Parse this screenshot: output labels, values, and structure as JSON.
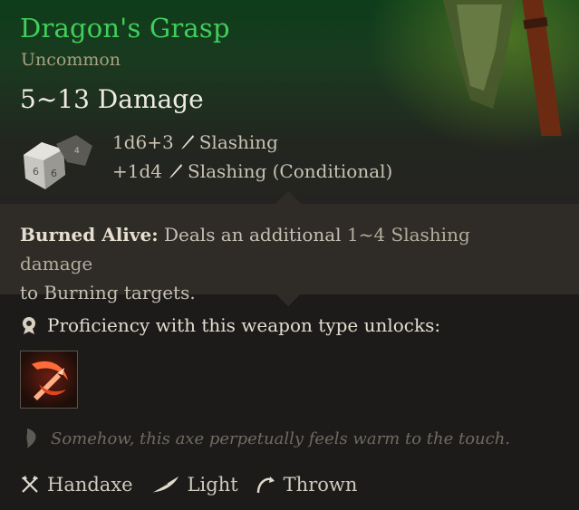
{
  "item": {
    "name": "Dragon's Grasp",
    "rarity": "Uncommon",
    "damage_range": "5~13 Damage",
    "damage_lines": [
      {
        "dice": "1d6+3",
        "type": "Slashing"
      },
      {
        "dice": "+1d4",
        "type": "Slashing (Conditional)"
      }
    ]
  },
  "passive": {
    "name": "Burned Alive:",
    "text_a": " Deals an additional ",
    "amount": "1~4 Slashing damage",
    "text_b": "to Burning targets."
  },
  "proficiency": {
    "label": "Proficiency with this weapon type unlocks:",
    "actions": [
      "flame-slash-action"
    ]
  },
  "flavor": "Somehow, this axe perpetually feels warm to the touch.",
  "properties": [
    {
      "label": "Handaxe",
      "icon": "crossed-axes-icon"
    },
    {
      "label": "Light",
      "icon": "feather-icon"
    },
    {
      "label": "Thrown",
      "icon": "throw-arc-icon"
    }
  ],
  "colors": {
    "name": "#3fcf5a",
    "rarity": "#a8a07e",
    "header_bg": "#0d3d1b",
    "body_bg": "#1d1b19"
  }
}
